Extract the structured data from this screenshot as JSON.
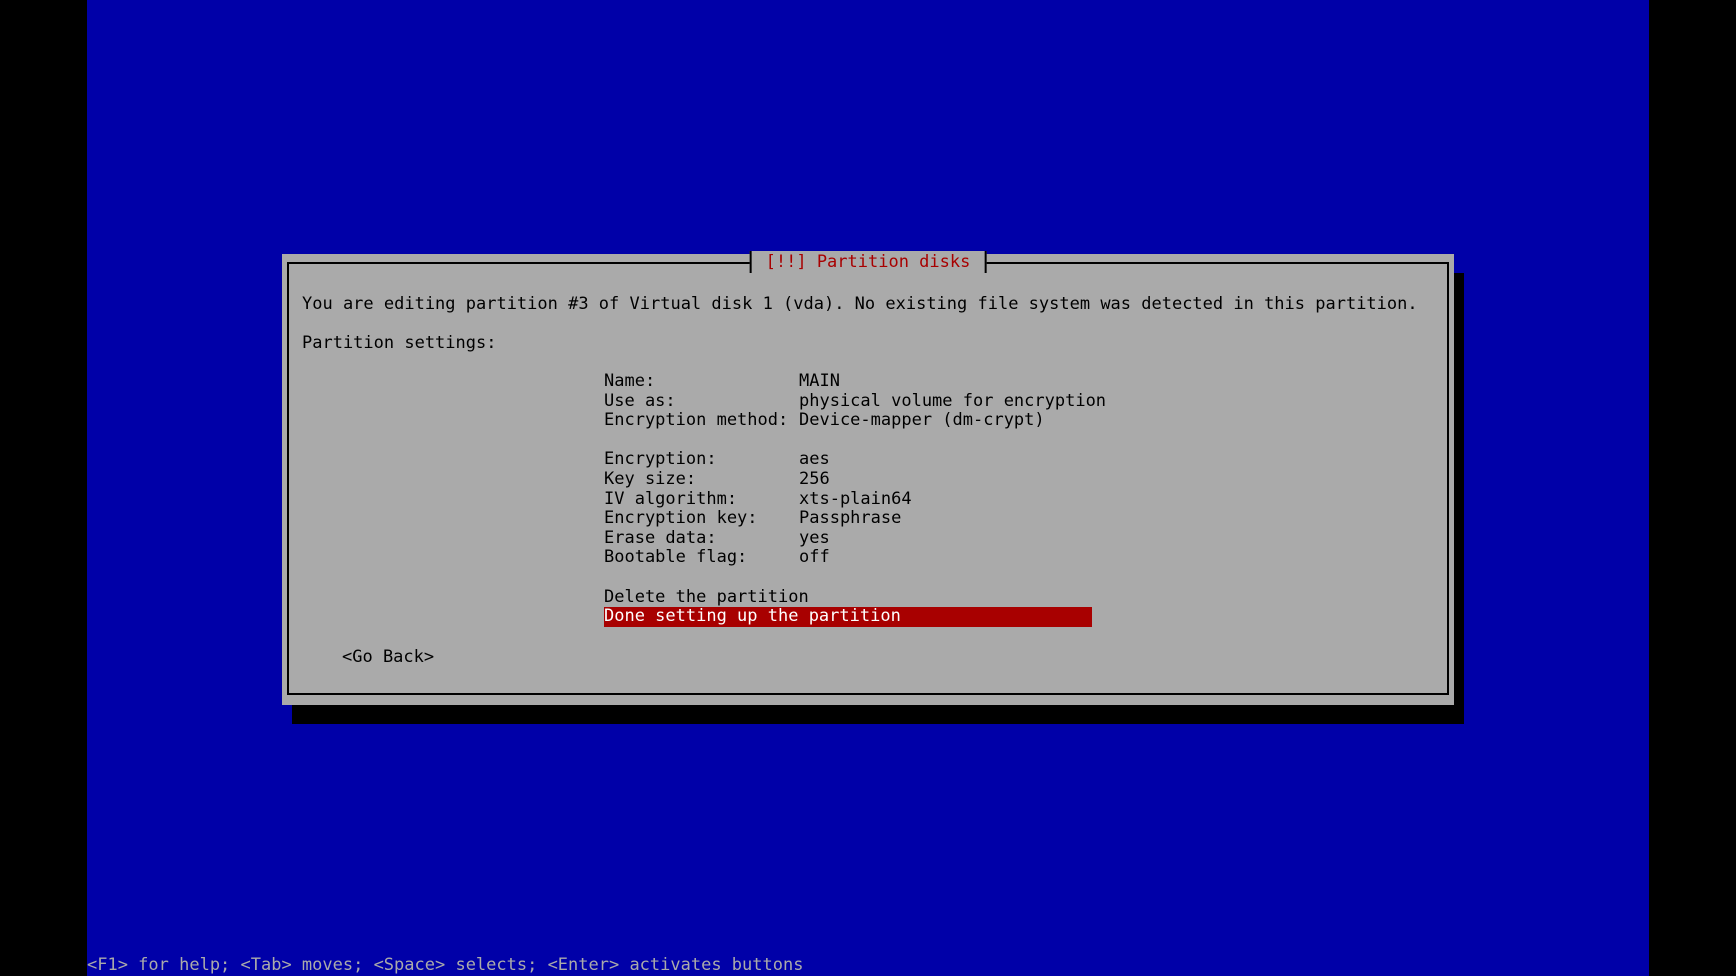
{
  "colors": {
    "background": "#0000a8",
    "dialog": "#aaaaaa",
    "title": "#a80000",
    "highlight": "#a80000",
    "help_text": "#aaaaaa"
  },
  "dialog": {
    "title": "[!!] Partition disks",
    "intro": "You are editing partition #3 of Virtual disk 1 (vda). No existing file system was detected in this partition.",
    "settings_label": "Partition settings:",
    "settings": [
      {
        "label": "Name:",
        "value": "MAIN"
      },
      {
        "label": "Use as:",
        "value": "physical volume for encryption"
      },
      {
        "label": "Encryption method:",
        "value": "Device-mapper (dm-crypt)"
      },
      {
        "label": "Encryption:",
        "value": "aes"
      },
      {
        "label": "Key size:",
        "value": "256"
      },
      {
        "label": "IV algorithm:",
        "value": "xts-plain64"
      },
      {
        "label": "Encryption key:",
        "value": "Passphrase"
      },
      {
        "label": "Erase data:",
        "value": "yes"
      },
      {
        "label": "Bootable flag:",
        "value": "off"
      }
    ],
    "actions": {
      "delete": "Delete the partition",
      "done": "Done setting up the partition"
    },
    "go_back": "<Go Back>"
  },
  "help_line": "<F1> for help; <Tab> moves; <Space> selects; <Enter> activates buttons"
}
